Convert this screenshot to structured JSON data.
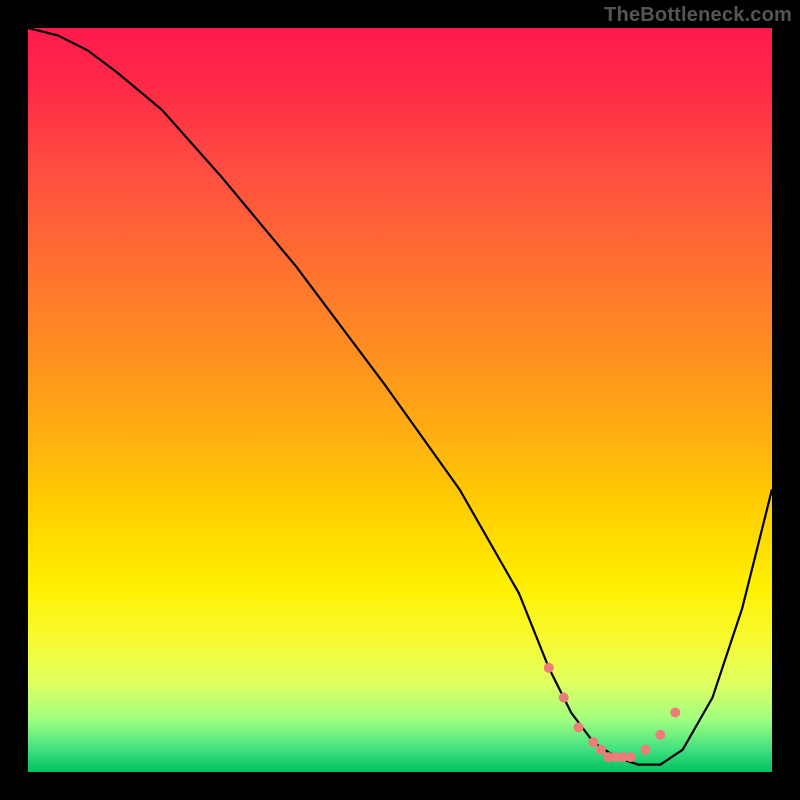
{
  "watermark": "TheBottleneck.com",
  "chart_data": {
    "type": "line",
    "title": "",
    "xlabel": "",
    "ylabel": "",
    "xlim": [
      0,
      100
    ],
    "ylim": [
      0,
      100
    ],
    "grid": false,
    "legend": false,
    "gradient_colors_top_to_bottom": [
      {
        "pos": 0.0,
        "hex": "#ff1a4d"
      },
      {
        "pos": 0.2,
        "hex": "#ff5040"
      },
      {
        "pos": 0.45,
        "hex": "#ff9020"
      },
      {
        "pos": 0.7,
        "hex": "#ffe000"
      },
      {
        "pos": 0.88,
        "hex": "#e0ff60"
      },
      {
        "pos": 0.97,
        "hex": "#40e080"
      },
      {
        "pos": 1.0,
        "hex": "#00c060"
      }
    ],
    "series": [
      {
        "name": "bottleneck-curve",
        "color": "#000000",
        "x": [
          0,
          4,
          8,
          12,
          18,
          26,
          36,
          48,
          58,
          66,
          70,
          73,
          76,
          79,
          82,
          85,
          88,
          92,
          96,
          100
        ],
        "y": [
          100,
          99,
          97,
          94,
          89,
          80,
          68,
          52,
          38,
          24,
          14,
          8,
          4,
          2,
          1,
          1,
          3,
          10,
          22,
          38
        ]
      }
    ],
    "markers": {
      "name": "flat-valley-dots",
      "type": "scatter",
      "color": "#ee7c78",
      "radius_px": 5,
      "x": [
        70,
        72,
        74,
        76,
        77,
        78,
        79,
        80,
        81,
        83,
        85,
        87
      ],
      "y": [
        14,
        10,
        6,
        4,
        3,
        2,
        2,
        2,
        2,
        3,
        5,
        8
      ]
    }
  }
}
